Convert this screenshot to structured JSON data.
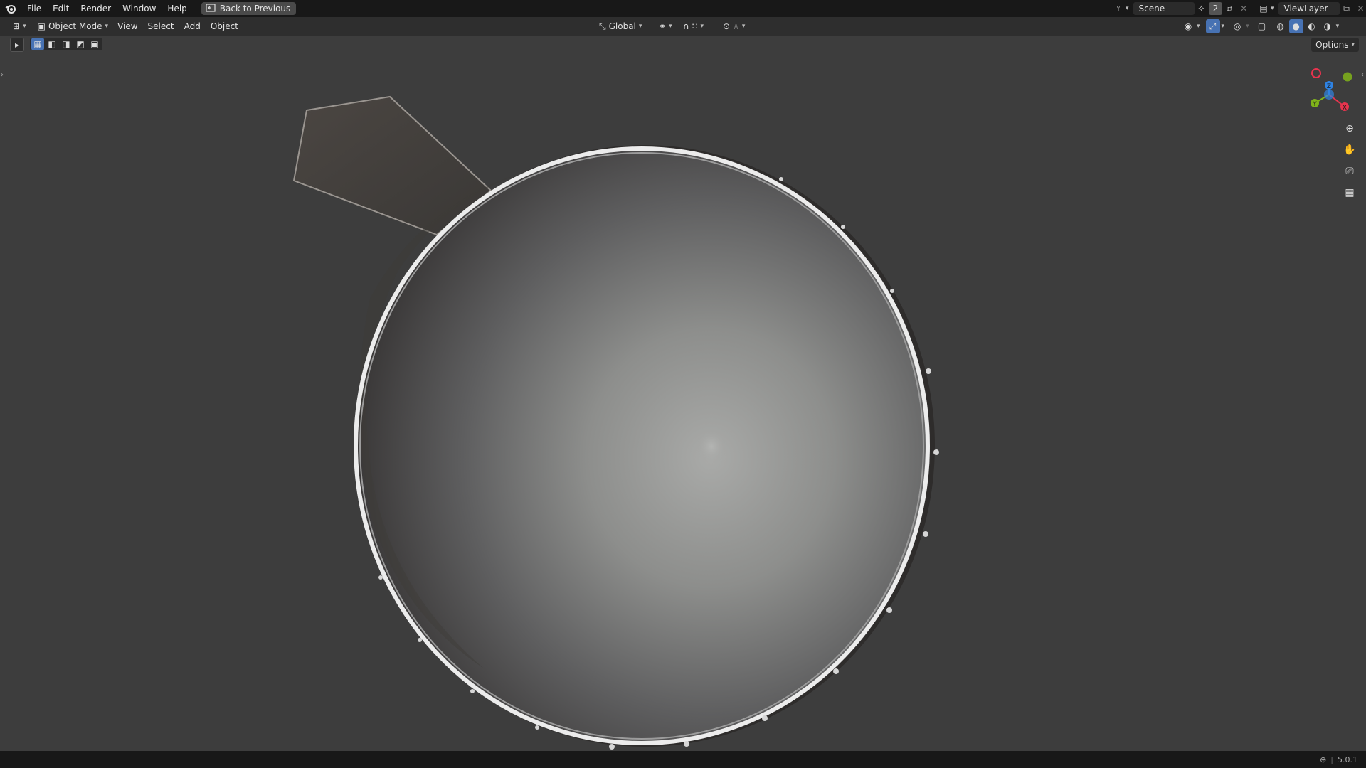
{
  "menu": {
    "items": [
      "File",
      "Edit",
      "Render",
      "Window",
      "Help"
    ],
    "back_button": "Back to Previous"
  },
  "scene": {
    "name": "Scene",
    "users": "2"
  },
  "view_layer": {
    "name": "ViewLayer"
  },
  "header": {
    "mode": "Object Mode",
    "menus": [
      "View",
      "Select",
      "Add",
      "Object"
    ],
    "orientation": "Global",
    "options": "Options"
  },
  "gizmo": {
    "z_label": "Z",
    "y_label": "Y",
    "x_label": "X"
  },
  "status": {
    "version": "5.0.1"
  },
  "colors": {
    "accent": "#4772b3",
    "x_axis": "#e8344e",
    "y_axis": "#80b31a",
    "z_axis": "#2f83e3"
  }
}
